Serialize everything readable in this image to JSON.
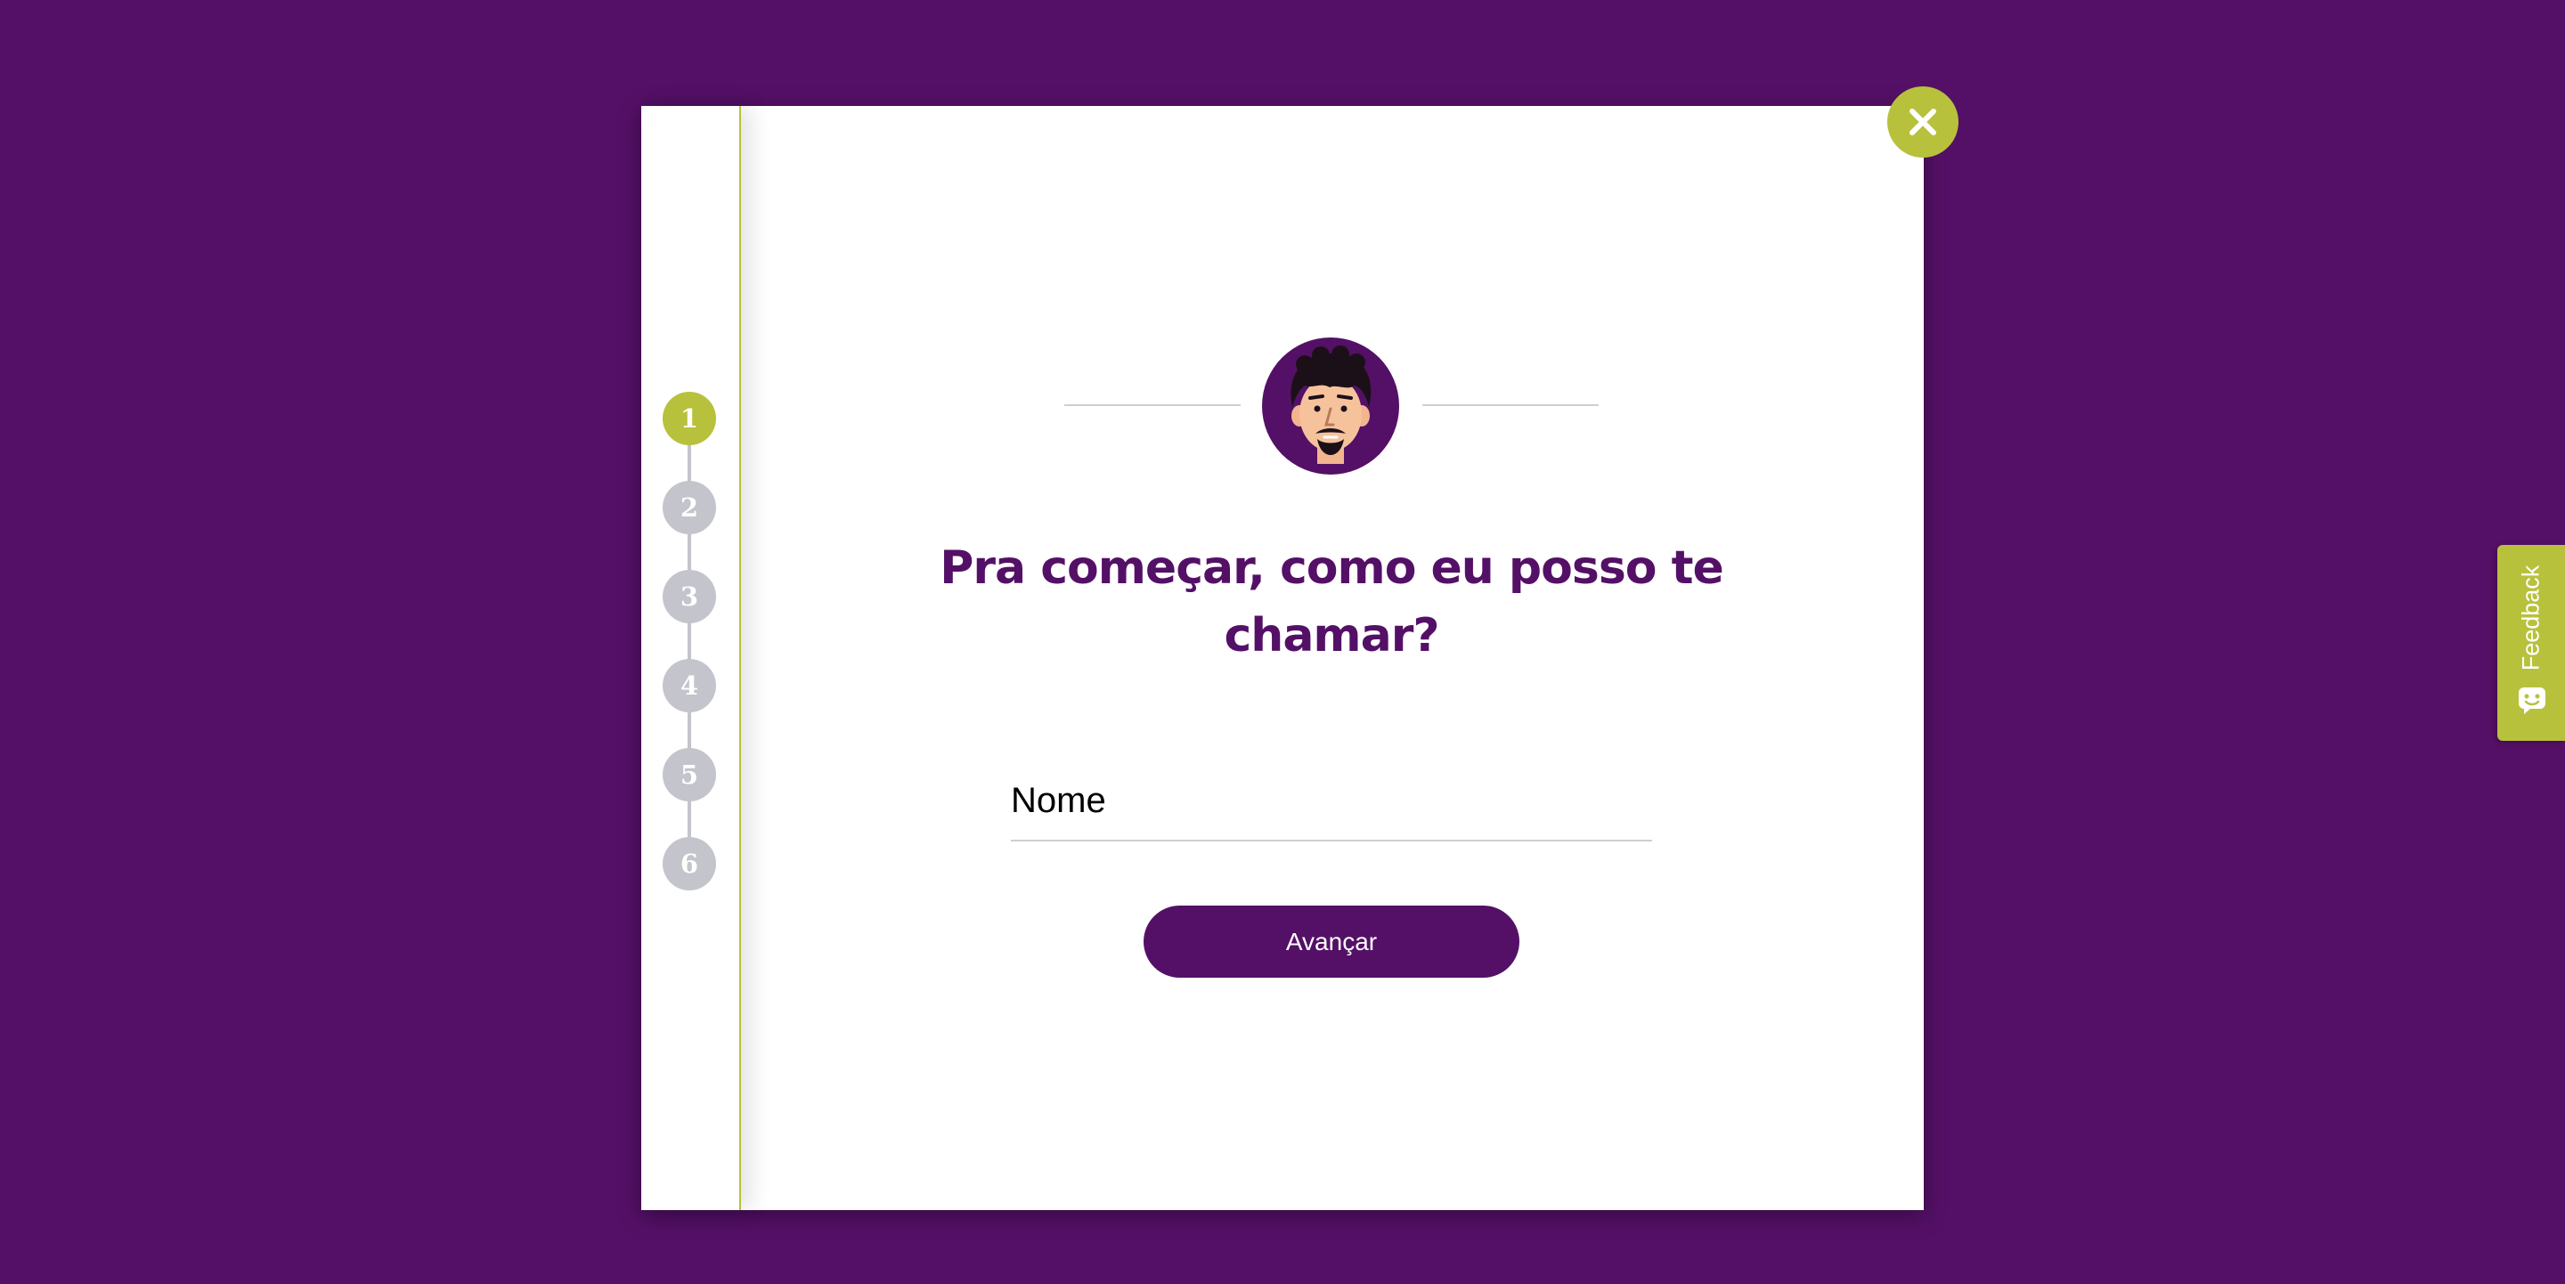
{
  "modal": {
    "steps": [
      {
        "number": "1",
        "state": "active"
      },
      {
        "number": "2",
        "state": "inactive"
      },
      {
        "number": "3",
        "state": "inactive"
      },
      {
        "number": "4",
        "state": "inactive"
      },
      {
        "number": "5",
        "state": "inactive"
      },
      {
        "number": "6",
        "state": "inactive"
      }
    ],
    "close_icon": "close-icon",
    "avatar_icon": "bearded-man-avatar-icon",
    "title": "Pra começar, como eu posso te chamar?",
    "name_input": {
      "placeholder": "Nome",
      "value": ""
    },
    "advance_label": "Avançar"
  },
  "feedback_tab": {
    "label": "Feedback",
    "icon": "chat-bubble-icon"
  },
  "colors": {
    "background": "#541066",
    "accent": "#b8c13c",
    "step_inactive": "#c4c4cc",
    "primary_text": "#541066"
  }
}
